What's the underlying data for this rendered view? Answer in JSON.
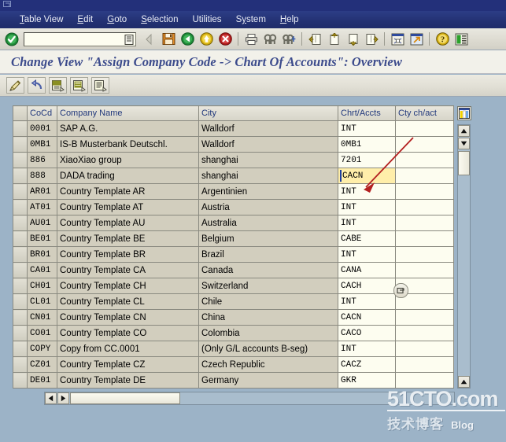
{
  "window": {
    "system_icon": "window-restore-icon"
  },
  "menubar": {
    "items": [
      {
        "label": "Table View",
        "accel": "T"
      },
      {
        "label": "Edit",
        "accel": "E"
      },
      {
        "label": "Goto",
        "accel": "G"
      },
      {
        "label": "Selection",
        "accel": "S"
      },
      {
        "label": "Utilities",
        "accel": ""
      },
      {
        "label": "System",
        "accel": "y"
      },
      {
        "label": "Help",
        "accel": "H"
      }
    ]
  },
  "system_toolbar": {
    "command_field": {
      "value": "",
      "placeholder": ""
    },
    "buttons": [
      {
        "name": "enter-check-icon",
        "title": "Enter"
      },
      {
        "name": "command-field-dropdown-icon",
        "title": "Command field"
      },
      {
        "name": "back-arrow-icon",
        "title": "Back"
      },
      {
        "name": "save-disk-icon",
        "title": "Save"
      },
      {
        "name": "green-back-icon",
        "title": "Back"
      },
      {
        "name": "yellow-exit-icon",
        "title": "Exit"
      },
      {
        "name": "red-cancel-icon",
        "title": "Cancel"
      },
      {
        "name": "print-icon",
        "title": "Print"
      },
      {
        "name": "find-icon",
        "title": "Find"
      },
      {
        "name": "find-next-icon",
        "title": "Find next"
      },
      {
        "name": "first-page-icon",
        "title": "First page"
      },
      {
        "name": "previous-page-icon",
        "title": "Previous page"
      },
      {
        "name": "next-page-icon",
        "title": "Next page"
      },
      {
        "name": "last-page-icon",
        "title": "Last page"
      },
      {
        "name": "new-session-icon",
        "title": "Create new session"
      },
      {
        "name": "create-shortcut-icon",
        "title": "Create shortcut"
      },
      {
        "name": "help-icon",
        "title": "Help"
      },
      {
        "name": "customize-layout-icon",
        "title": "Customizing of local layout"
      }
    ]
  },
  "page": {
    "title": "Change View \"Assign Company Code -> Chart Of Accounts\": Overview"
  },
  "app_toolbar": {
    "buttons": [
      {
        "name": "display-change-pencil-icon",
        "title": "Display/Change"
      },
      {
        "name": "undo-arrow-icon",
        "title": "Undo"
      },
      {
        "name": "select-all-list-icon",
        "title": "Select All"
      },
      {
        "name": "deselect-all-list-icon",
        "title": "Deselect All"
      },
      {
        "name": "variable-list-icon",
        "title": "Select variable list"
      }
    ]
  },
  "table": {
    "columns": [
      {
        "key": "cocd",
        "label": "CoCd",
        "editable": false
      },
      {
        "key": "name",
        "label": "Company Name",
        "editable": false
      },
      {
        "key": "city",
        "label": "City",
        "editable": false
      },
      {
        "key": "chrt",
        "label": "Chrt/Accts",
        "editable": true
      },
      {
        "key": "cty",
        "label": "Cty ch/act",
        "editable": true
      }
    ],
    "layout_button": "table-layout-icon",
    "active_cell": {
      "row": 3,
      "column": "chrt",
      "value": "CACN",
      "highlight_color": "#ffeeaa"
    },
    "f4_button": "dropdown-search-help-icon",
    "rows": [
      {
        "cocd": "0001",
        "name": "SAP A.G.",
        "city": "Walldorf",
        "chrt": "INT",
        "cty": ""
      },
      {
        "cocd": "0MB1",
        "name": "IS-B Musterbank Deutschl.",
        "city": "Walldorf",
        "chrt": "0MB1",
        "cty": ""
      },
      {
        "cocd": "886",
        "name": "XiaoXiao group",
        "city": "shanghai",
        "chrt": "7201",
        "cty": ""
      },
      {
        "cocd": "888",
        "name": "DADA trading",
        "city": "shanghai",
        "chrt": "CACN",
        "cty": ""
      },
      {
        "cocd": "AR01",
        "name": "Country Template AR",
        "city": "Argentinien",
        "chrt": "INT",
        "cty": ""
      },
      {
        "cocd": "AT01",
        "name": "Country Template AT",
        "city": "Austria",
        "chrt": "INT",
        "cty": ""
      },
      {
        "cocd": "AU01",
        "name": "Country Template AU",
        "city": "Australia",
        "chrt": "INT",
        "cty": ""
      },
      {
        "cocd": "BE01",
        "name": "Country Template BE",
        "city": "Belgium",
        "chrt": "CABE",
        "cty": ""
      },
      {
        "cocd": "BR01",
        "name": "Country Template BR",
        "city": "Brazil",
        "chrt": "INT",
        "cty": ""
      },
      {
        "cocd": "CA01",
        "name": "Country Template CA",
        "city": "Canada",
        "chrt": "CANA",
        "cty": ""
      },
      {
        "cocd": "CH01",
        "name": "Country Template CH",
        "city": "Switzerland",
        "chrt": "CACH",
        "cty": ""
      },
      {
        "cocd": "CL01",
        "name": "Country Template CL",
        "city": "Chile",
        "chrt": "INT",
        "cty": ""
      },
      {
        "cocd": "CN01",
        "name": "Country Template CN",
        "city": "China",
        "chrt": "CACN",
        "cty": ""
      },
      {
        "cocd": "CO01",
        "name": "Country Template CO",
        "city": "Colombia",
        "chrt": "CACO",
        "cty": ""
      },
      {
        "cocd": "COPY",
        "name": "Copy from CC.0001",
        "city": "(Only G/L accounts B-seg)",
        "chrt": "INT",
        "cty": ""
      },
      {
        "cocd": "CZ01",
        "name": "Country Template CZ",
        "city": "Czech Republic",
        "chrt": "CACZ",
        "cty": ""
      },
      {
        "cocd": "DE01",
        "name": "Country Template DE",
        "city": "Germany",
        "chrt": "GKR",
        "cty": ""
      }
    ]
  },
  "scrollbars": {
    "vertical": {
      "up": "scroll-up-icon",
      "down": "scroll-down-icon",
      "bottom": "scroll-bottom-icon"
    },
    "horizontal": {
      "left": "scroll-left-icon",
      "right": "scroll-right-icon"
    }
  },
  "annotation": {
    "arrow_color": "#b32020",
    "points_to": "active-chrt-accts-cell"
  },
  "watermark": {
    "main": "51CTO.com",
    "sub": "技术博客",
    "blog": "Blog"
  },
  "colors": {
    "menubar": "#243274",
    "title_text": "#3c4b8c",
    "readonly_cell": "#d2cebe",
    "editable_cell": "#fdfdf0",
    "active_cell": "#ffeeaa",
    "desktop": "#9cb3c7"
  }
}
